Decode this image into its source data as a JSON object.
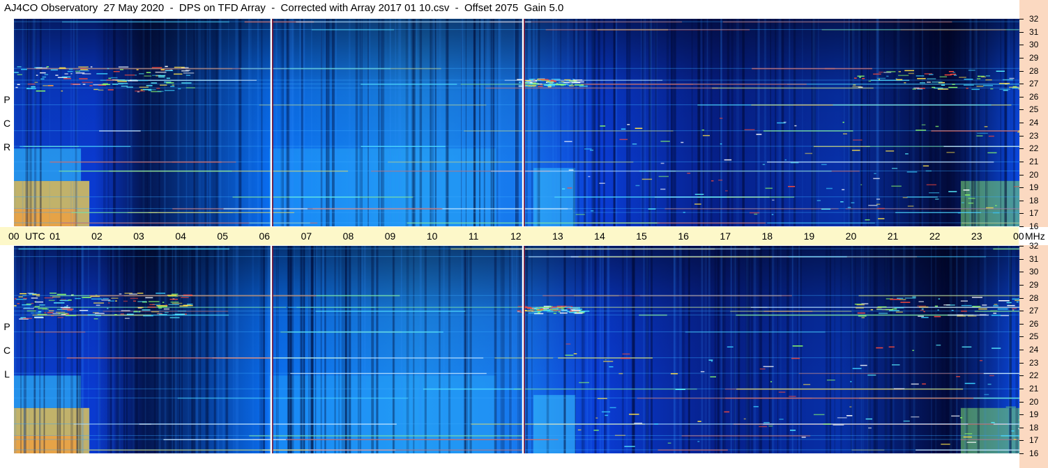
{
  "header": {
    "title": "AJ4CO Observatory  27 May 2020  -  DPS on TFD Array  -  Corrected with Array 2017 01 10.csv  -  Offset 2075  Gain 5.0"
  },
  "panels": {
    "rcp": {
      "label_chars": [
        "P",
        "C",
        "R"
      ]
    },
    "lcp": {
      "label_chars": [
        "P",
        "C",
        "L"
      ]
    }
  },
  "chart_data": {
    "type": "heatmap",
    "title": "AJ4CO Observatory  27 May 2020  -  DPS on TFD Array  -  Corrected with Array 2017 01 10.csv  -  Offset 2075  Gain 5.0",
    "xlabel": "UTC",
    "ylabel": "MHz",
    "x_ticks": [
      "00",
      "UTC",
      "01",
      "02",
      "03",
      "04",
      "05",
      "06",
      "07",
      "08",
      "09",
      "10",
      "11",
      "12",
      "13",
      "14",
      "15",
      "16",
      "17",
      "18",
      "19",
      "20",
      "21",
      "22",
      "23",
      "00",
      "MHz"
    ],
    "y_ticks": [
      "32",
      "31",
      "30",
      "29",
      "28",
      "27",
      "26",
      "25",
      "24",
      "23",
      "22",
      "21",
      "20",
      "19",
      "18",
      "17",
      "16"
    ],
    "xlim": [
      0,
      24
    ],
    "ylim": [
      16,
      32
    ],
    "series": [
      {
        "name": "R C P",
        "description_colormap": "blue-cyan-yellow-red"
      },
      {
        "name": "L C P",
        "description_colormap": "blue-cyan-yellow-red"
      }
    ],
    "colors": {
      "low": "#000020",
      "mid": "#0a4fe0",
      "high": "#2fd8ff",
      "hot": "#ffe14a",
      "max": "#ff3030"
    }
  }
}
